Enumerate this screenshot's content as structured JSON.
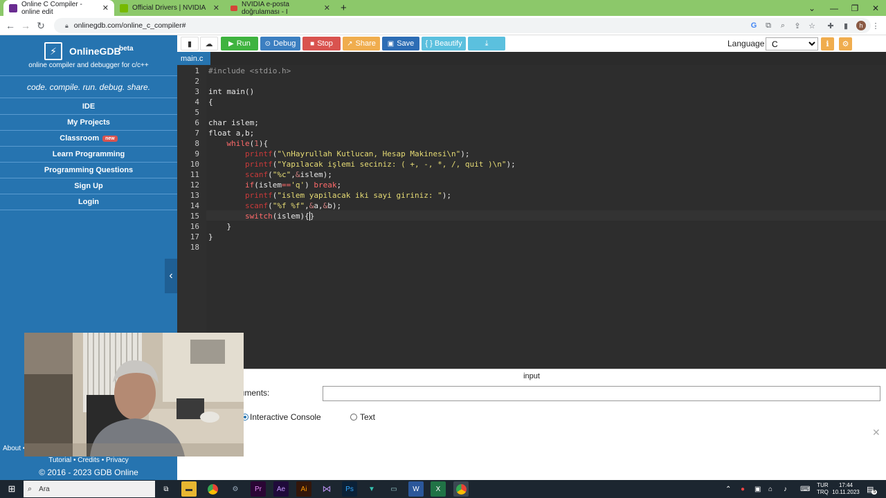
{
  "browser": {
    "tabs": [
      {
        "title": "Online C Compiler - online edit",
        "active": true,
        "favicon_color": "#6a2c91"
      },
      {
        "title": "Official Drivers | NVIDIA",
        "active": false,
        "favicon_color": "#76b900"
      },
      {
        "title": "NVIDIA e-posta doğrulaması - I",
        "active": false,
        "favicon_color": "#d44638"
      }
    ],
    "new_tab": "+",
    "url": "onlinegdb.com/online_c_compiler#"
  },
  "sidebar": {
    "brand_name": "OnlineGDB",
    "brand_beta": "beta",
    "brand_sub": "online compiler and debugger for c/c++",
    "tagline": "code. compile. run. debug. share.",
    "items": [
      {
        "label": "IDE"
      },
      {
        "label": "My Projects"
      },
      {
        "label": "Classroom",
        "badge": "new"
      },
      {
        "label": "Learn Programming"
      },
      {
        "label": "Programming Questions"
      },
      {
        "label": "Sign Up"
      },
      {
        "label": "Login"
      }
    ],
    "about": "About •",
    "footer_links": "Tutorial • Credits • Privacy",
    "copyright": "© 2016 - 2023 GDB Online"
  },
  "toolbar": {
    "run": "Run",
    "debug": "Debug",
    "stop": "Stop",
    "share": "Share",
    "save": "Save",
    "beautify": "{ } Beautify",
    "language_label": "Language",
    "language_value": "C"
  },
  "editor": {
    "file_tab": "main.c",
    "line_numbers": [
      "1",
      "2",
      "3",
      "4",
      "5",
      "6",
      "7",
      "8",
      "9",
      "10",
      "11",
      "12",
      "13",
      "14",
      "15",
      "16",
      "17",
      "18"
    ]
  },
  "input_panel": {
    "title": "input",
    "args_label": "guments:",
    "mode_interactive": "Interactive Console",
    "mode_text": "Text",
    "selected_mode": "Interactive Console"
  },
  "taskbar": {
    "search_placeholder": "Ara",
    "lang_top": "TUR",
    "lang_bottom": "TRQ",
    "time": "17:44",
    "date": "10.11.2023",
    "notification_count": "5"
  },
  "colors": {
    "sidebar": "#2674b0",
    "run": "#3fb33f",
    "debug": "#3c7fc1",
    "stop": "#d9534f",
    "share": "#f0ad4e",
    "save": "#2d6db5",
    "beautify": "#5bc0de",
    "editor_bg": "#2d2d2d"
  }
}
